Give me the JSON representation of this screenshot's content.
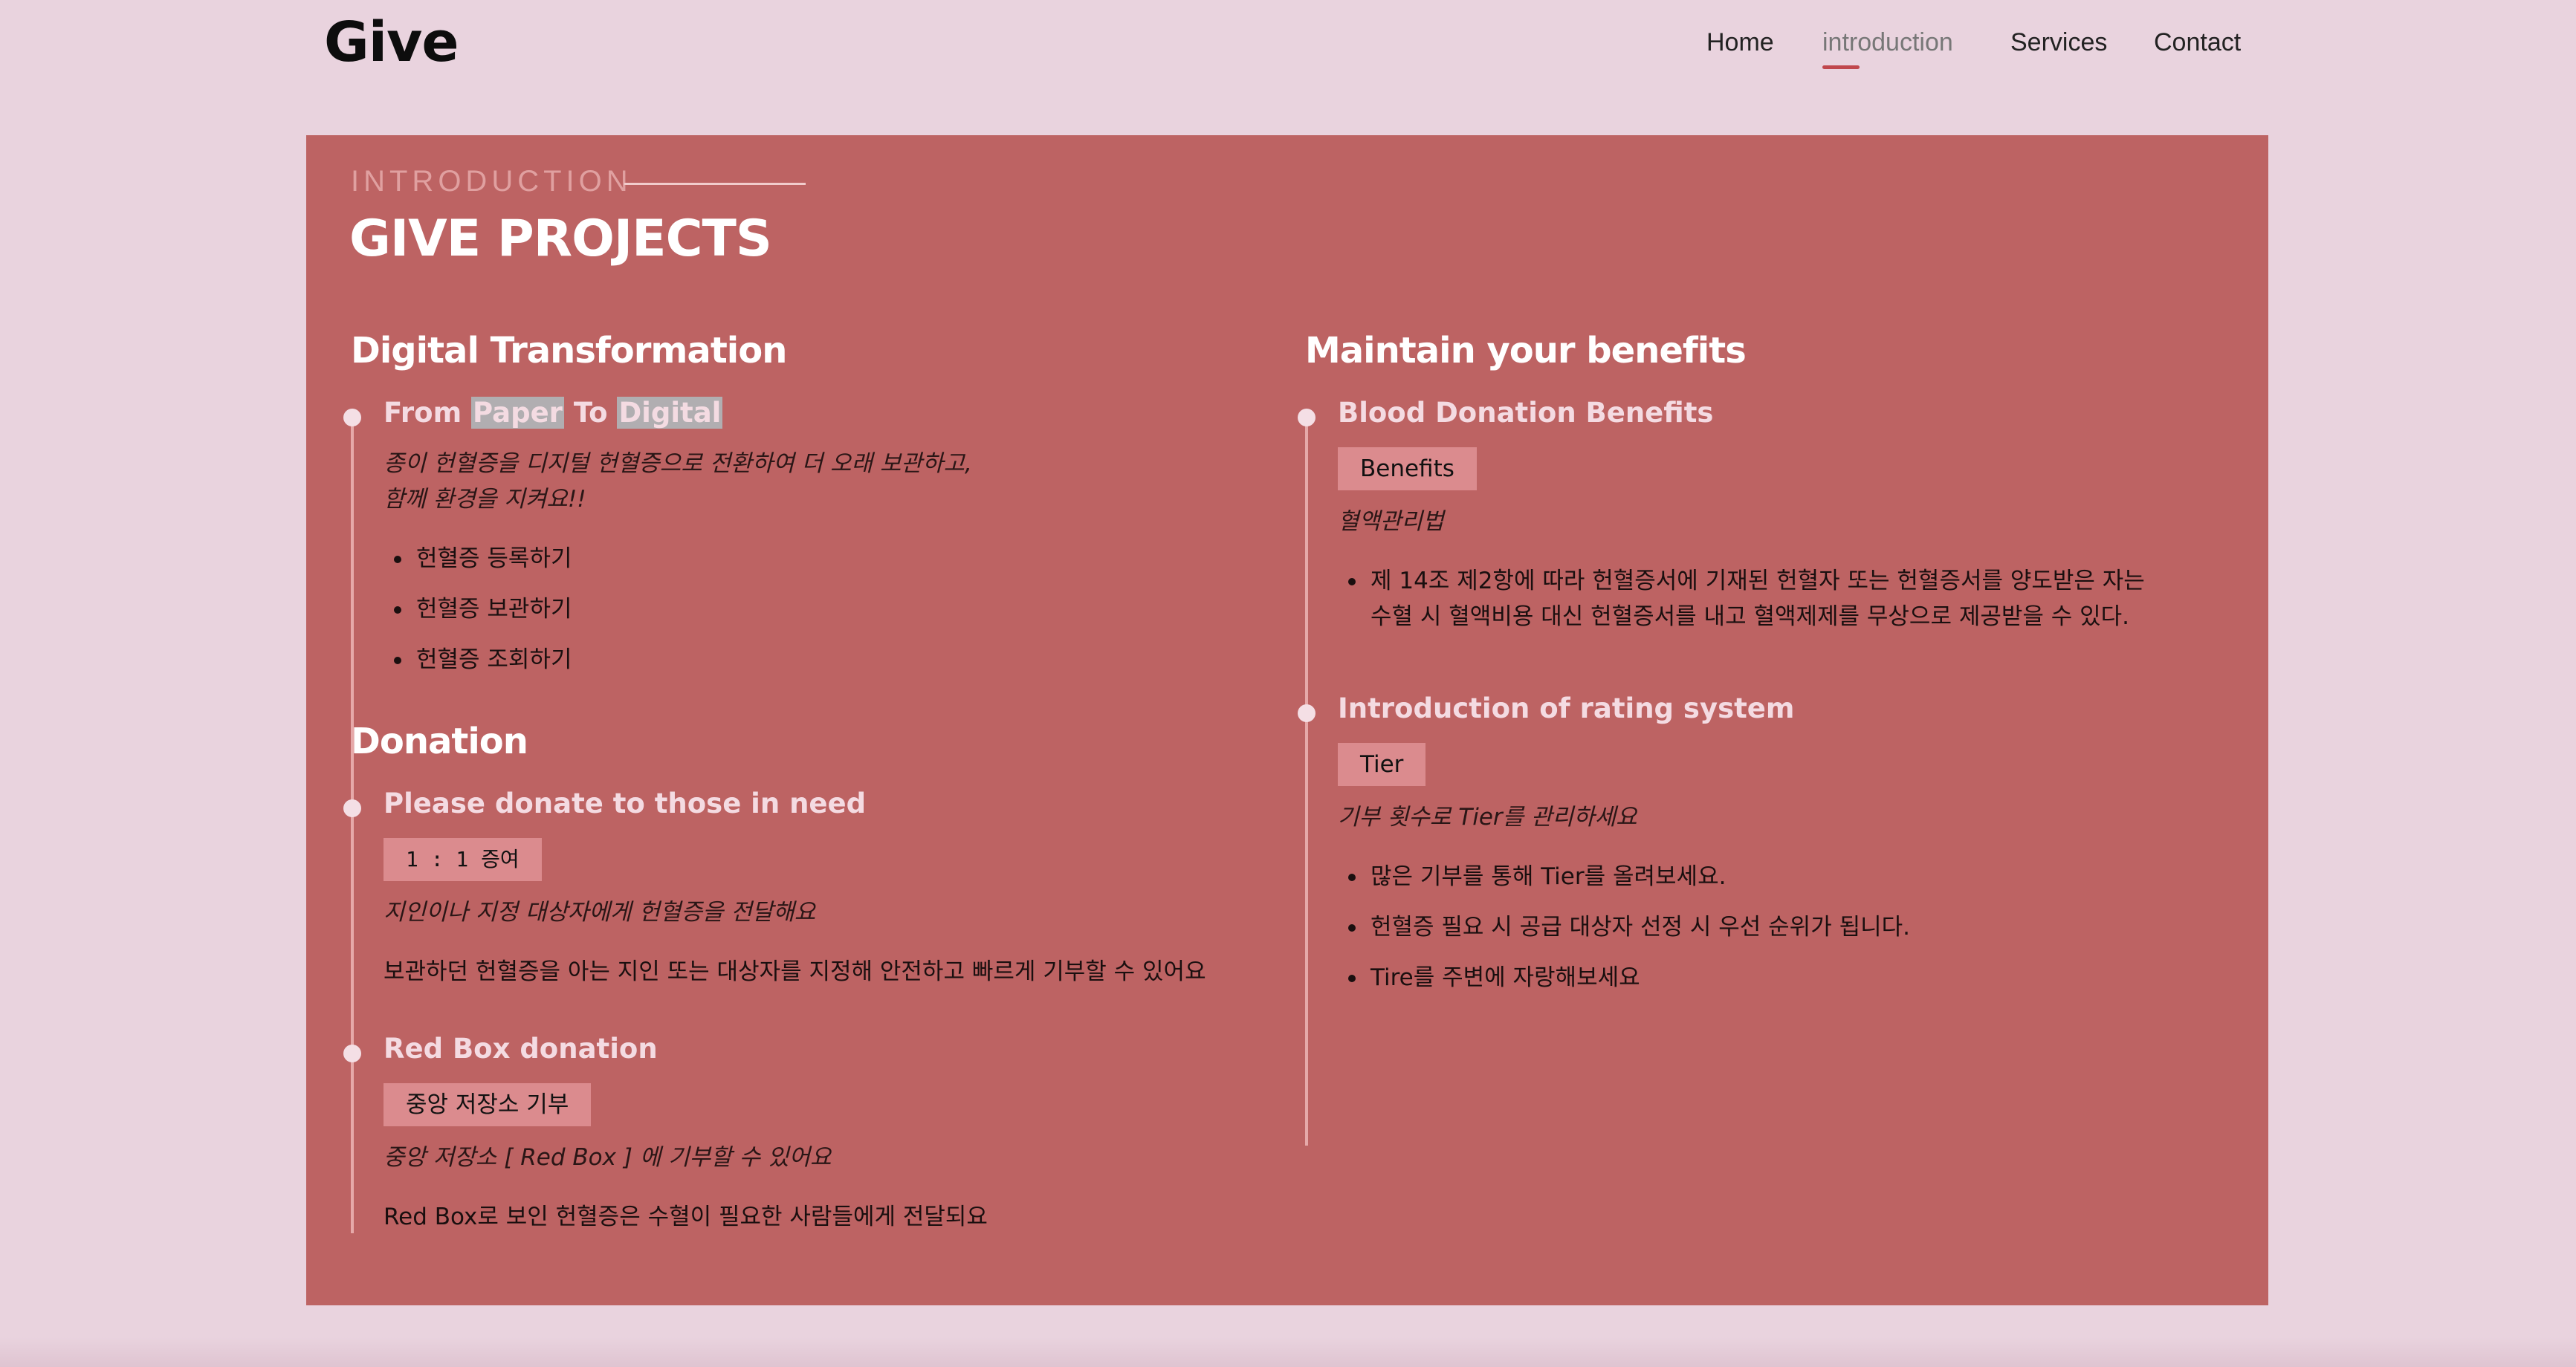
{
  "header": {
    "logo": "Give",
    "nav": [
      {
        "label": "Home"
      },
      {
        "label": "introduction"
      },
      {
        "label": "Services"
      },
      {
        "label": "Contact"
      }
    ],
    "active_nav": "introduction"
  },
  "section": {
    "eyebrow": "INTRODUCTION",
    "title": "GIVE PROJECTS"
  },
  "left": {
    "digital": {
      "heading": "Digital Transformation",
      "item": {
        "title_parts": [
          "From ",
          "Paper",
          " To ",
          "Digital"
        ],
        "desc_lines": [
          "종이 헌혈증을 디지털 헌혈증으로 전환하여 더 오래 보관하고,",
          "함께 환경을 지켜요!!"
        ],
        "bullets": [
          "헌혈증 등록하기",
          "헌혈증 보관하기",
          "헌혈증 조회하기"
        ]
      }
    },
    "donation": {
      "heading": "Donation",
      "items": [
        {
          "title": "Please donate to those in need",
          "tag": "1 : 1 증여",
          "subtitle": "지인이나 지정 대상자에게 헌혈증을 전달해요",
          "text": "보관하던 헌혈증을 아는 지인 또는 대상자를 지정해 안전하고 빠르게 기부할 수 있어요"
        },
        {
          "title": "Red Box donation",
          "tag": "중앙 저장소 기부",
          "subtitle": "중앙 저장소 [ Red Box ] 에 기부할 수 있어요",
          "text": "Red Box로 보인 헌혈증은 수혈이 필요한 사람들에게 전달되요"
        }
      ]
    }
  },
  "right": {
    "heading": "Maintain your benefits",
    "items": [
      {
        "title": "Blood Donation Benefits",
        "tag": "Benefits",
        "subtitle": "혈액관리법",
        "bullet_lines": [
          "제 14조 제2항에 따라 헌혈증서에 기재된 헌혈자 또는 헌혈증서를 양도받은 자는",
          "수혈 시 혈액비용 대신 헌혈증서를 내고 혈액제제를 무상으로 제공받을 수 있다."
        ]
      },
      {
        "title": "Introduction of rating system",
        "tag": "Tier",
        "subtitle": "기부 횟수로 Tier를 관리하세요",
        "bullets": [
          "많은 기부를 통해 Tier를 올려보세요.",
          "헌혈증 필요 시 공급 대상자 선정 시 우선 순위가 됩니다.",
          "Tire를 주변에 자랑해보세요"
        ]
      }
    ]
  },
  "colors": {
    "background": "#e9d3de",
    "panel": "#bd6363",
    "accent": "#c0474d",
    "tag": "#db8b8e"
  }
}
